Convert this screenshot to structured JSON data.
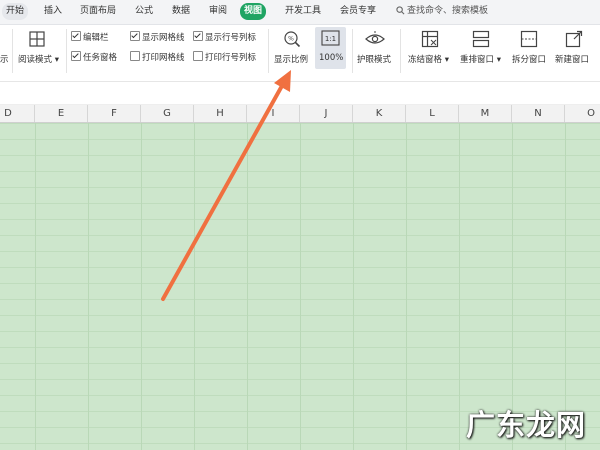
{
  "menu": {
    "tabs": [
      "开始",
      "插入",
      "页面布局",
      "公式",
      "数据",
      "审阅",
      "视图",
      "开发工具",
      "会员专享"
    ],
    "active_tab": "视图",
    "search_placeholder": "查找命令、搜索模板"
  },
  "ribbon": {
    "partial_label": "示",
    "reading_mode": "阅读模式",
    "checkboxes": {
      "edit_bar": "编辑栏",
      "task_pane": "任务窗格",
      "show_gridlines": "显示网格线",
      "print_gridlines": "打印网格线",
      "show_headers": "显示行号列标",
      "print_headers": "打印行号列标"
    },
    "zoom": "显示比例",
    "zoom_100": "100%",
    "eye_mode": "护眼模式",
    "freeze": "冻结窗格",
    "arrange": "重排窗口",
    "split": "拆分窗口",
    "new_window": "新建窗口",
    "zoom_icon_text": "1:1"
  },
  "columns": [
    "D",
    "E",
    "F",
    "G",
    "H",
    "I",
    "J",
    "K",
    "L",
    "M",
    "N",
    "O"
  ],
  "colors": {
    "active_tab": "#1fa463",
    "grid_fill": "#cde6cc",
    "arrow": "#f07040"
  },
  "watermark": "广东龙网"
}
